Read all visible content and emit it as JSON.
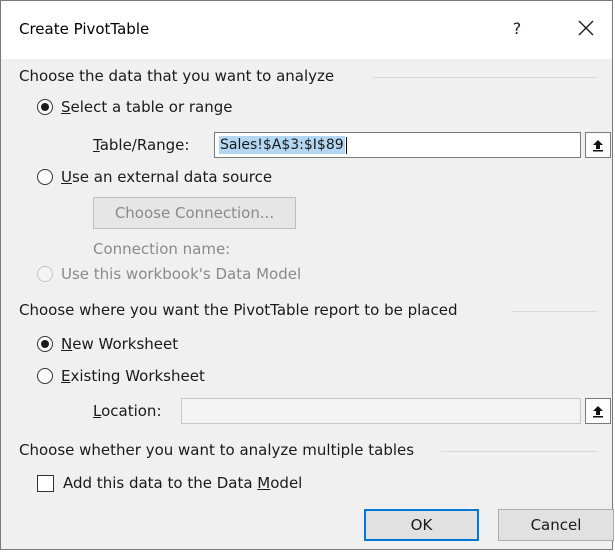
{
  "dialog": {
    "title": "Create PivotTable",
    "help_label": "?"
  },
  "data_section": {
    "label": "Choose the data that you want to analyze",
    "select_range": {
      "label_access": "S",
      "label_rest": "elect a table or range",
      "checked": true
    },
    "table_range": {
      "label_access": "T",
      "label_rest": "able/Range:",
      "value": "Sales!$A$3:$I$89"
    },
    "external_source": {
      "label_access": "U",
      "label_rest": "se an external data source",
      "checked": false
    },
    "choose_connection_label": "Choose Connection...",
    "connection_name_label": "Connection name:",
    "data_model_option": {
      "label": "Use this workbook's Data Model",
      "checked": false,
      "disabled": true
    }
  },
  "placement_section": {
    "label": "Choose where you want the PivotTable report to be placed",
    "new_worksheet": {
      "label_access": "N",
      "label_rest": "ew Worksheet",
      "checked": true
    },
    "existing_worksheet": {
      "label_access": "E",
      "label_rest": "xisting Worksheet",
      "checked": false
    },
    "location": {
      "label_access": "L",
      "label_rest": "ocation:",
      "value": ""
    }
  },
  "multi_section": {
    "label": "Choose whether you want to analyze multiple tables",
    "add_to_model": {
      "label_pre": "Add this data to the Data ",
      "label_access": "M",
      "label_rest": "odel",
      "checked": false
    }
  },
  "buttons": {
    "ok_label": "OK",
    "cancel_label": "Cancel"
  },
  "icons": {
    "close": "close-icon",
    "collapse": "collapse-dialog-icon"
  },
  "colors": {
    "accent": "#0078d7",
    "selection": "#b3d7f3",
    "dialog_bg": "#f0f0f0"
  }
}
